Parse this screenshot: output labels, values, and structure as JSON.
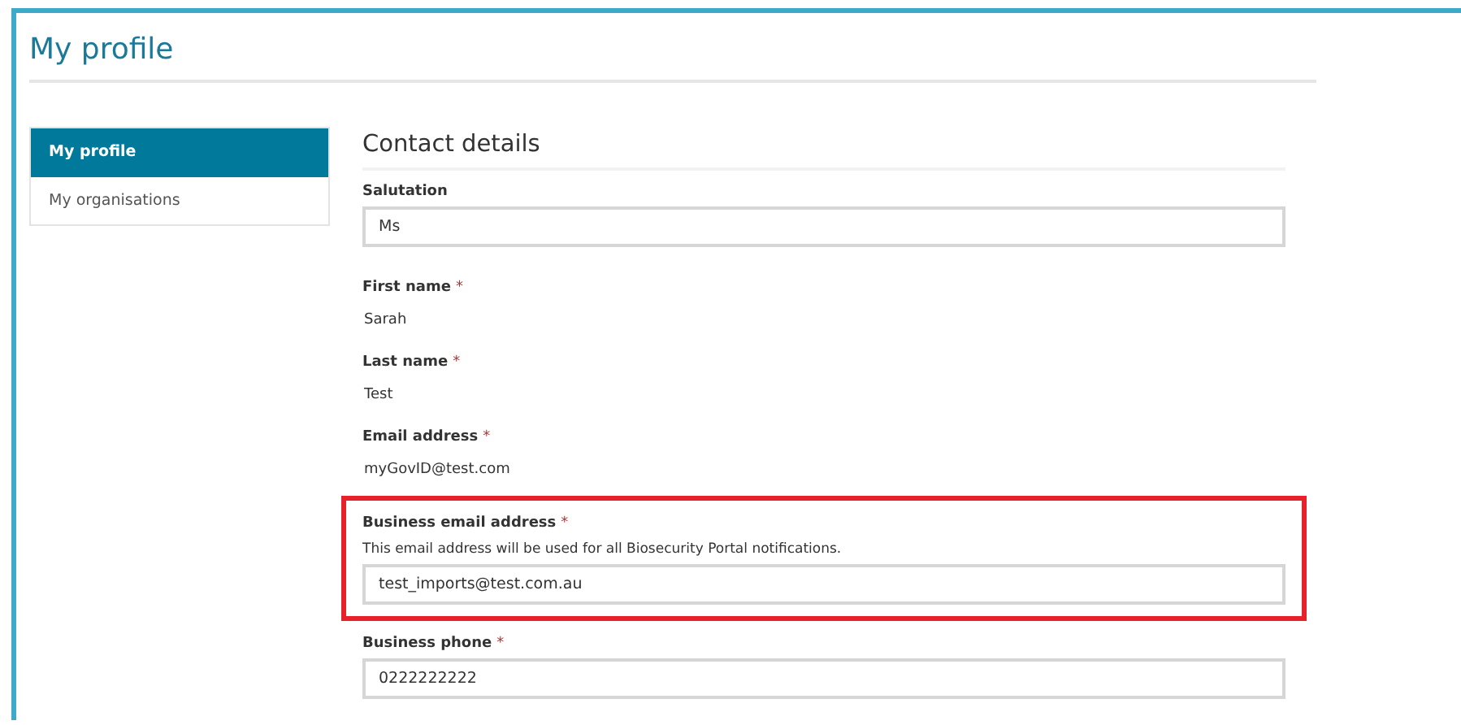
{
  "page": {
    "title": "My profile"
  },
  "sidebar": {
    "items": [
      {
        "label": "My profile",
        "selected": true
      },
      {
        "label": "My organisations",
        "selected": false
      }
    ]
  },
  "section": {
    "title": "Contact details"
  },
  "fields": [
    {
      "kind": "input",
      "label": "Salutation",
      "value": "Ms",
      "highlighted": false
    },
    {
      "kind": "text",
      "label": "First name",
      "required_mark": "*",
      "value": "Sarah",
      "highlighted": false
    },
    {
      "kind": "text",
      "label": "Last name",
      "required_mark": "*",
      "value": "Test",
      "highlighted": false
    },
    {
      "kind": "text",
      "label": "Email address",
      "required_mark": "*",
      "value": "myGovID@test.com",
      "highlighted": false
    },
    {
      "kind": "input",
      "label": "Business email address",
      "required_mark": "*",
      "help": "This email address will be used for all Biosecurity Portal notifications.",
      "value": "test_imports@test.com.au",
      "highlighted": true
    },
    {
      "kind": "input",
      "label": "Business phone",
      "required_mark": "*",
      "value": "0222222222",
      "highlighted": false
    }
  ]
}
